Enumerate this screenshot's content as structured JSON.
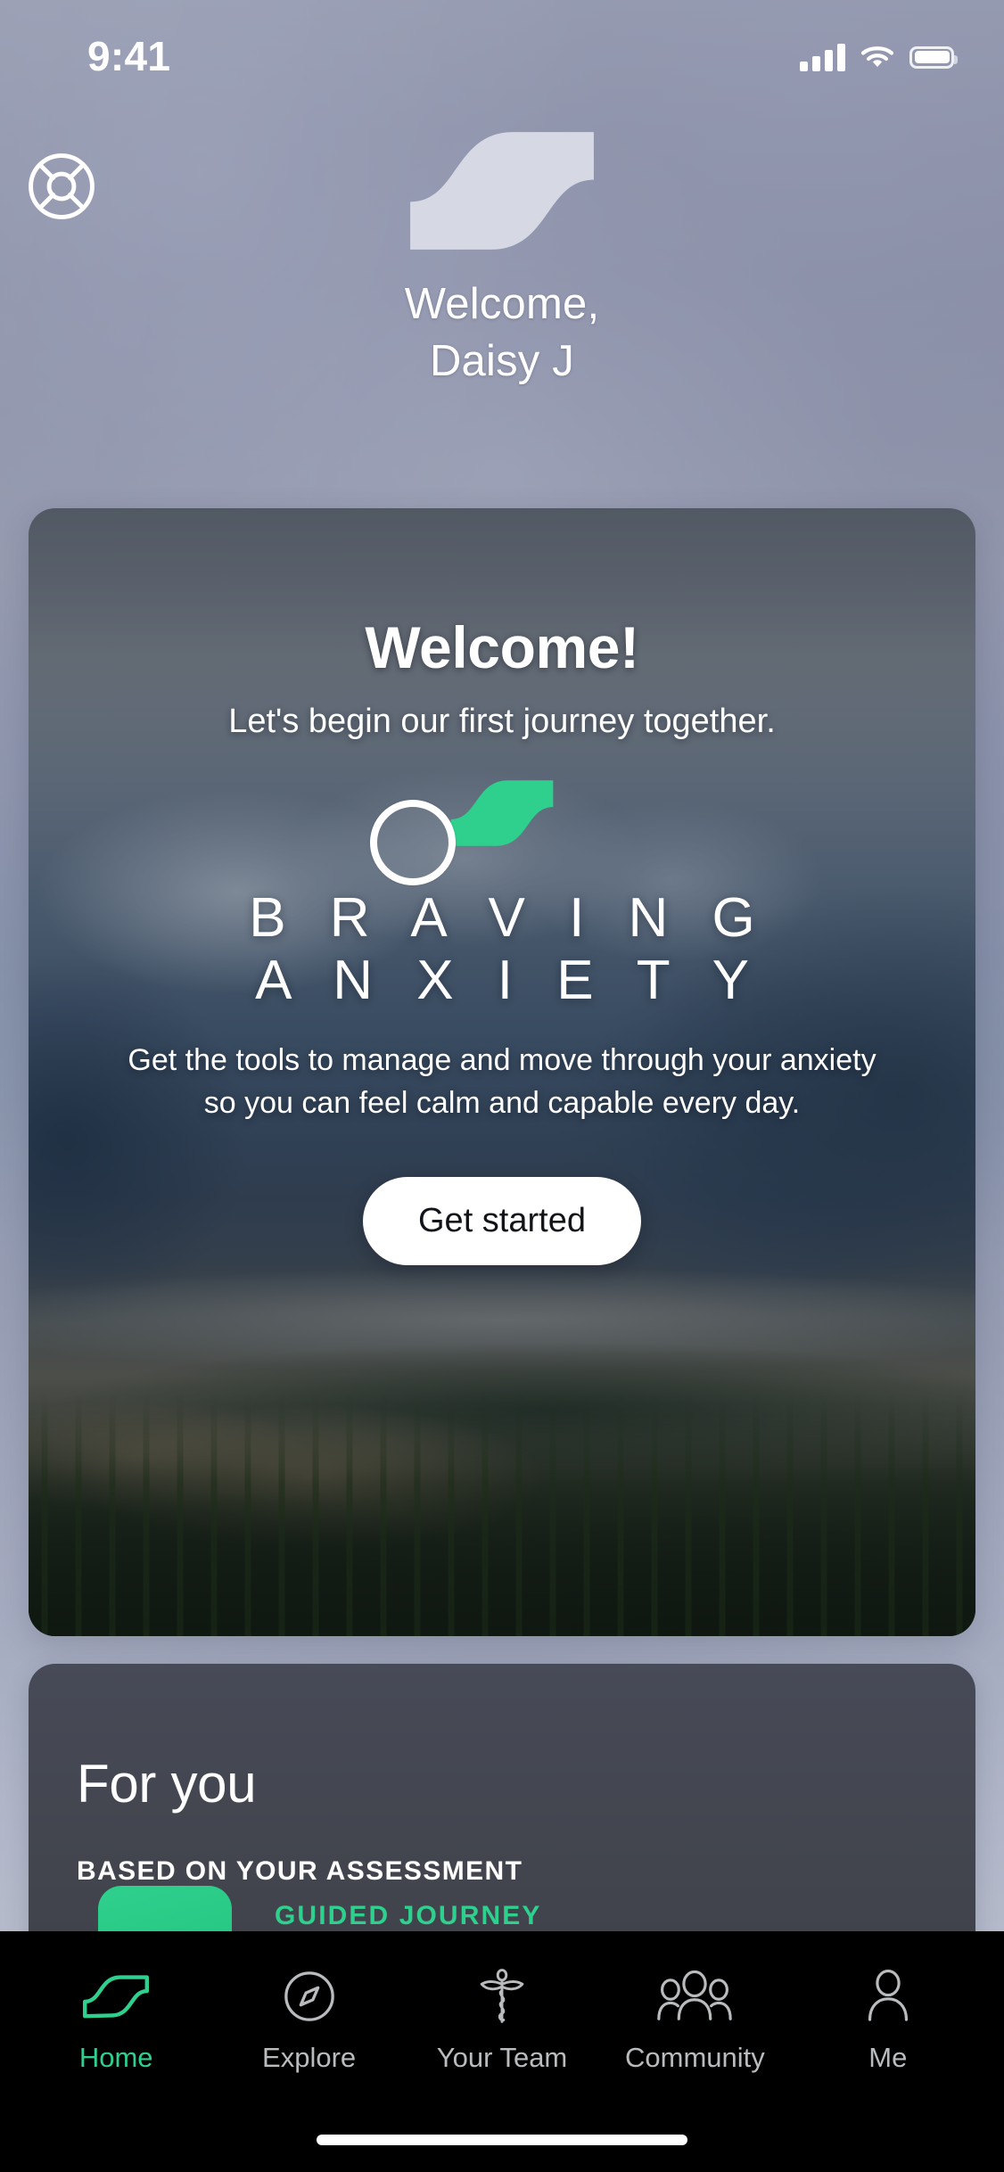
{
  "status_bar": {
    "time": "9:41",
    "signal_icon": "cellular-signal-icon",
    "wifi_icon": "wifi-icon",
    "battery_icon": "battery-icon"
  },
  "header": {
    "brand_mark_icon": "life-ring-logo-icon",
    "wave_logo_icon": "wave-logo-icon",
    "greeting_line1": "Welcome,",
    "greeting_line2": "Daisy J"
  },
  "hero_card": {
    "welcome_heading": "Welcome!",
    "welcome_subtitle": "Let's begin our first journey together.",
    "wave_icon": "wave-accent-icon",
    "program_title_line1": "B R A V I N G",
    "program_title_line2": "A N X I E T Y",
    "description_line1": "Get the tools to manage and move through your anxiety",
    "description_line2": "so you can feel calm and capable every day.",
    "cta_label": "Get started"
  },
  "for_you": {
    "title": "For you",
    "subtitle": "BASED ON YOUR ASSESSMENT",
    "item": {
      "kicker": "GUIDED JOURNEY",
      "thumbnail_icon": "journey-thumbnail"
    }
  },
  "tab_bar": {
    "items": [
      {
        "label": "Home",
        "icon": "wave-home-icon",
        "active": true
      },
      {
        "label": "Explore",
        "icon": "compass-icon",
        "active": false
      },
      {
        "label": "Your Team",
        "icon": "caduceus-icon",
        "active": false
      },
      {
        "label": "Community",
        "icon": "people-group-icon",
        "active": false
      },
      {
        "label": "Me",
        "icon": "person-icon",
        "active": false
      }
    ]
  },
  "cursor": {
    "indicator_icon": "cursor-ring-indicator"
  },
  "colors": {
    "accent_green": "#2FD08D",
    "tab_inactive": "#B9BCBF",
    "tab_bar_bg": "#000000",
    "card_dark": "#43464F",
    "cta_bg": "#FFFFFF",
    "text_on_dark": "#FFFFFF"
  }
}
